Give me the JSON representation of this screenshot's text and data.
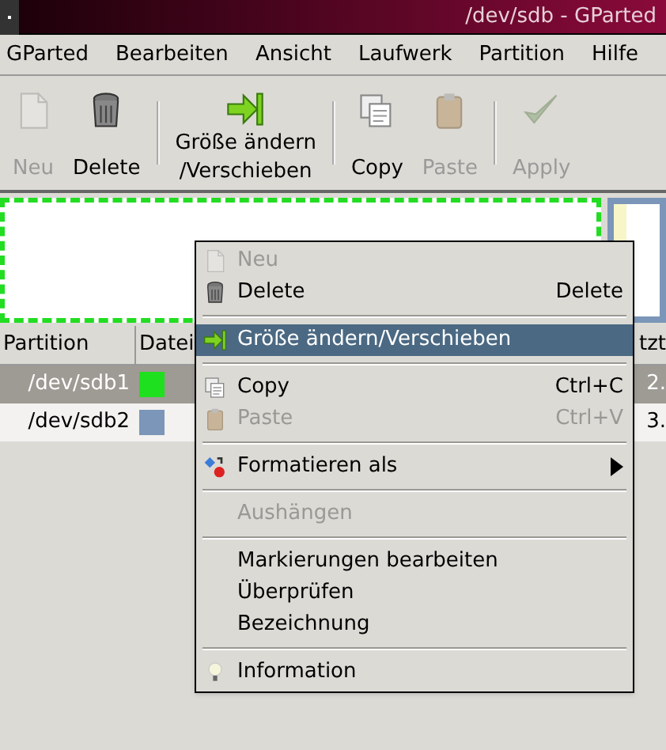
{
  "window": {
    "title": "/dev/sdb - GParted"
  },
  "menubar": [
    "GParted",
    "Bearbeiten",
    "Ansicht",
    "Laufwerk",
    "Partition",
    "Hilfe"
  ],
  "toolbar": [
    {
      "kind": "button",
      "label": "Neu",
      "disabled": true
    },
    {
      "kind": "button",
      "label": "Delete",
      "disabled": false
    },
    {
      "kind": "separator"
    },
    {
      "kind": "button",
      "label": "Größe ändern\n/Verschieben",
      "disabled": false
    },
    {
      "kind": "separator"
    },
    {
      "kind": "button",
      "label": "Copy",
      "disabled": false
    },
    {
      "kind": "button",
      "label": "Paste",
      "disabled": true
    },
    {
      "kind": "separator"
    },
    {
      "kind": "button",
      "label": "Apply",
      "disabled": true
    }
  ],
  "disk_map": [
    {
      "color": "#22dd22",
      "selected": true
    },
    {
      "color": "#7b96b8",
      "selected": false
    }
  ],
  "table": {
    "columns": [
      "Partition",
      "Datei",
      "tzt"
    ],
    "rows": [
      {
        "partition": "/dev/sdb1",
        "color": "#1ee01e",
        "column_3": "2.",
        "selected": true
      },
      {
        "partition": "/dev/sdb2",
        "color": "#7b96b8",
        "column_3": "3.",
        "selected": false
      }
    ]
  },
  "context_menu": [
    {
      "kind": "item",
      "label": "Neu",
      "disabled": true,
      "selected": false
    },
    {
      "kind": "item",
      "label": "Delete",
      "shortcut": "Delete",
      "disabled": false,
      "selected": false
    },
    {
      "kind": "separator"
    },
    {
      "kind": "item",
      "label": "Größe ändern/Verschieben",
      "disabled": false,
      "selected": true
    },
    {
      "kind": "separator"
    },
    {
      "kind": "item",
      "label": "Copy",
      "shortcut": "Ctrl+C",
      "disabled": false,
      "selected": false
    },
    {
      "kind": "item",
      "label": "Paste",
      "shortcut": "Ctrl+V",
      "disabled": true,
      "selected": false
    },
    {
      "kind": "separator"
    },
    {
      "kind": "item",
      "label": "Formatieren als",
      "submenu": true,
      "disabled": false,
      "selected": false
    },
    {
      "kind": "separator"
    },
    {
      "kind": "item",
      "label": "Aushängen",
      "disabled": true,
      "selected": false
    },
    {
      "kind": "separator"
    },
    {
      "kind": "item",
      "label": "Markierungen bearbeiten",
      "disabled": false,
      "selected": false
    },
    {
      "kind": "item",
      "label": "Überprüfen",
      "disabled": false,
      "selected": false
    },
    {
      "kind": "item",
      "label": "Bezeichnung",
      "disabled": false,
      "selected": false
    },
    {
      "kind": "separator"
    },
    {
      "kind": "item",
      "label": "Information",
      "disabled": false,
      "selected": false
    }
  ]
}
